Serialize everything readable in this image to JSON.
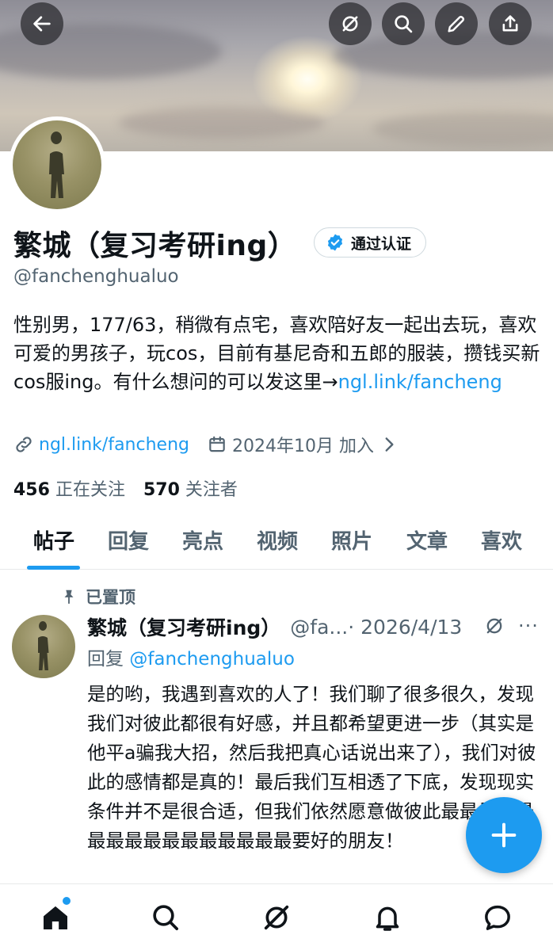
{
  "header": {
    "back_icon": "arrow-left-icon",
    "actions": [
      "grok-icon",
      "search-icon",
      "pencil-icon",
      "share-icon"
    ]
  },
  "profile": {
    "name": "繁城（复习考研ing）",
    "verified_label": "通过认证",
    "handle": "@fanchenghualuo",
    "bio_text": "性别男，177/63，稍微有点宅，喜欢陪好友一起出去玩，喜欢可爱的男孩子，玩cos，目前有基尼奇和五郎的服装，攒钱买新cos服ing。有什么想问的可以发这里→",
    "bio_link": "ngl.link/fancheng",
    "link": "ngl.link/fancheng",
    "joined": "2024年10月 加入",
    "following_count": "456",
    "following_label": "正在关注",
    "followers_count": "570",
    "followers_label": "关注者"
  },
  "tabs": [
    "帖子",
    "回复",
    "亮点",
    "视频",
    "照片",
    "文章",
    "喜欢"
  ],
  "post": {
    "pinned_label": "已置顶",
    "name": "繁城（复习考研ing）",
    "handle": "@fa...",
    "date": "· 2026/4/13",
    "more": "···",
    "reply_prefix": "回复",
    "reply_to": "@fanchenghualuo",
    "body": "是的哟，我遇到喜欢的人了！我们聊了很多很久，发现我们对彼此都很有好感，并且都希望更进一步（其实是他平a骗我大招，然后我把真心话说出来了），我们对彼此的感情都是真的！最后我们互相透了下底，发现现实条件并不是很合适，但我们依然愿意做彼此最最最最最最最最最最最最最最最最要好的朋友！"
  },
  "fab_icon": "plus-icon",
  "bottom_nav": [
    "home-icon",
    "search-icon",
    "grok-icon",
    "bell-icon",
    "message-icon"
  ],
  "colors": {
    "accent": "#1d9bf0",
    "text": "#0f1419",
    "secondary": "#536471"
  }
}
